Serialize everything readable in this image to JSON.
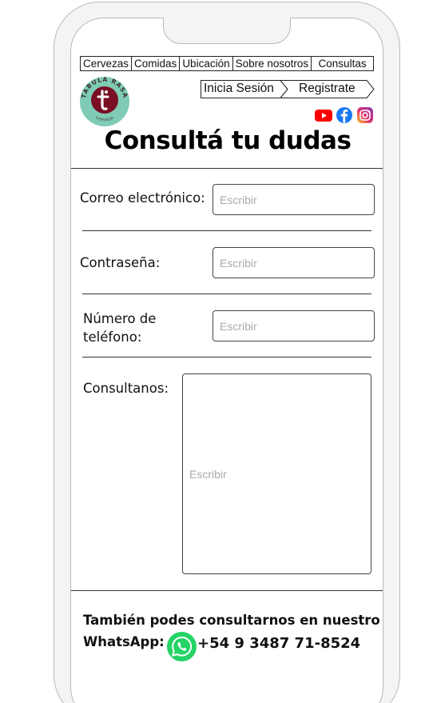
{
  "nav": {
    "items": [
      "Cervezas",
      "Comidas",
      "Ubicación",
      "Sobre nosotros",
      "Consultas"
    ]
  },
  "logo": {
    "text_top": "TABULA RASA",
    "text_bottom": "CERVEZA",
    "colors": {
      "background": "#7fcbb6",
      "circle": "#7a0e24",
      "mark": "#ffffff"
    }
  },
  "auth": {
    "login_label": "Inicia Sesión",
    "register_label": "Registrate"
  },
  "social": {
    "icons": [
      "youtube-icon",
      "facebook-icon",
      "instagram-icon"
    ],
    "colors": {
      "youtube": "#ff0000",
      "facebook": "#1877f2",
      "instagram": "#d6249f"
    }
  },
  "page": {
    "title": "Consultá tu dudas"
  },
  "form": {
    "email_label": "Correo electrónico:",
    "email_placeholder": "Escribir",
    "password_label": "Contraseña:",
    "password_placeholder": "Escribir",
    "phone_label_line1": "Número de",
    "phone_label_line2": "teléfono:",
    "phone_placeholder": "Escribir",
    "query_label": "Consultanos:",
    "query_placeholder": "Escribir"
  },
  "footer": {
    "line1": "También podes consultarnos en nuestro",
    "line2": "WhatsApp:",
    "whatsapp_number": "+54 9 3487 71-8524",
    "whatsapp_color": "#25d366"
  }
}
